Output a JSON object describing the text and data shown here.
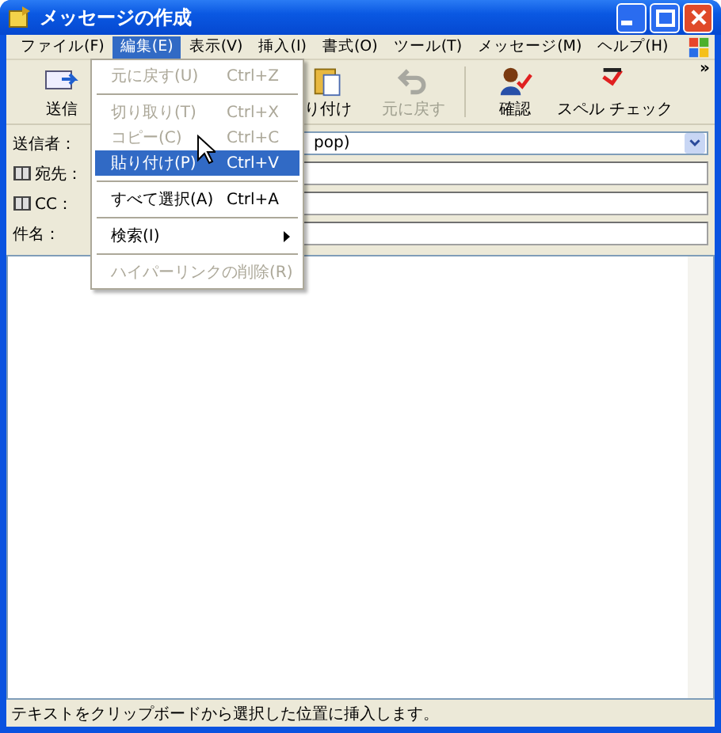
{
  "window": {
    "title": "メッセージの作成"
  },
  "menu_bar": [
    {
      "label": "ファイル(F)",
      "selected": false
    },
    {
      "label": "編集(E)",
      "selected": true
    },
    {
      "label": "表示(V)",
      "selected": false
    },
    {
      "label": "挿入(I)",
      "selected": false
    },
    {
      "label": "書式(O)",
      "selected": false
    },
    {
      "label": "ツール(T)",
      "selected": false
    },
    {
      "label": "メッセージ(M)",
      "selected": false
    },
    {
      "label": "ヘルプ(H)",
      "selected": false
    }
  ],
  "toolbar": [
    {
      "kind": "send",
      "label": "送信",
      "disabled": false
    },
    {
      "kind": "paste",
      "label": "り付け",
      "disabled": false
    },
    {
      "kind": "undo",
      "label": "元に戻す",
      "disabled": true
    },
    {
      "kind": "check",
      "label": "確認",
      "disabled": false
    },
    {
      "kind": "spell",
      "label": "スペル チェック",
      "disabled": false
    }
  ],
  "toolbar_overflow": "»",
  "header_fields": [
    {
      "kind": "from",
      "label": "送信者：",
      "value": "pop)"
    },
    {
      "kind": "to",
      "label": "宛先："
    },
    {
      "kind": "cc",
      "label": "CC："
    },
    {
      "kind": "subject",
      "label": "件名："
    }
  ],
  "edit_menu": [
    {
      "kind": "item",
      "label": "元に戻す(U)",
      "shortcut": "Ctrl+Z",
      "disabled": true,
      "selected": false
    },
    {
      "kind": "separator"
    },
    {
      "kind": "item",
      "label": "切り取り(T)",
      "shortcut": "Ctrl+X",
      "disabled": true,
      "selected": false
    },
    {
      "kind": "item",
      "label": "コピー(C)",
      "shortcut": "Ctrl+C",
      "disabled": true,
      "selected": false
    },
    {
      "kind": "item",
      "label": "貼り付け(P)",
      "shortcut": "Ctrl+V",
      "disabled": false,
      "selected": true
    },
    {
      "kind": "separator"
    },
    {
      "kind": "item",
      "label": "すべて選択(A)",
      "shortcut": "Ctrl+A",
      "disabled": false,
      "selected": false
    },
    {
      "kind": "separator"
    },
    {
      "kind": "submenu",
      "label": "検索(I)",
      "disabled": false,
      "selected": false
    },
    {
      "kind": "separator"
    },
    {
      "kind": "item",
      "label": "ハイパーリンクの削除(R)",
      "disabled": true,
      "selected": false
    }
  ],
  "status_bar": {
    "text": "テキストをクリップボードから選択した位置に挿入します。"
  }
}
